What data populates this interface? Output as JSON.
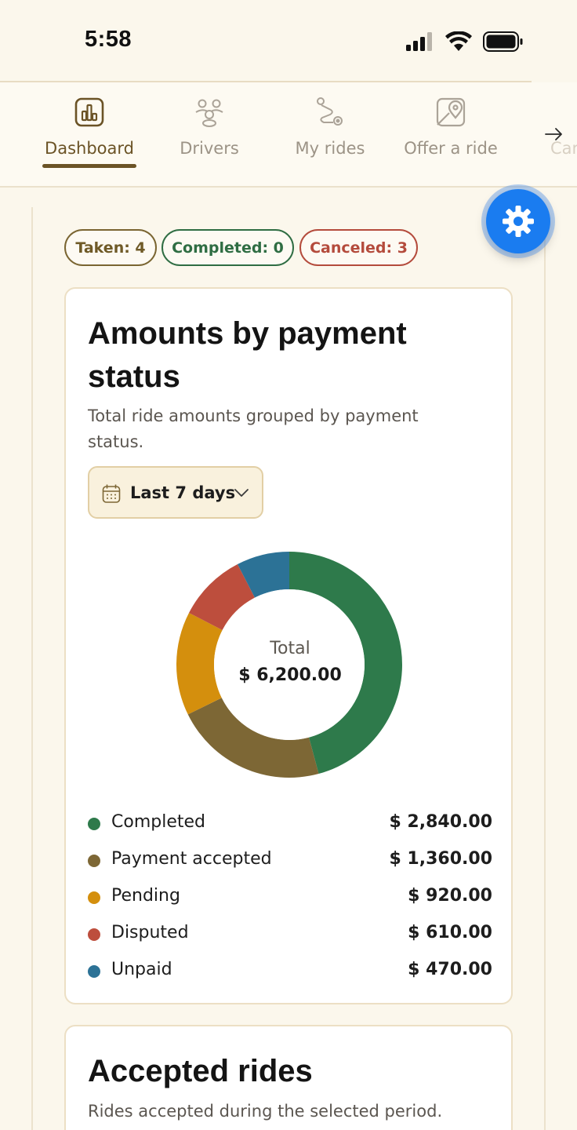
{
  "status_bar": {
    "time": "5:58",
    "icons": [
      "signal-icon",
      "wifi-icon",
      "battery-icon"
    ]
  },
  "nav": {
    "tabs": [
      {
        "label": "Dashboard",
        "icon": "chart-icon",
        "active": true
      },
      {
        "label": "Drivers",
        "icon": "drivers-icon",
        "active": false
      },
      {
        "label": "My rides",
        "icon": "route-icon",
        "active": false
      },
      {
        "label": "Offer a ride",
        "icon": "map-pin-icon",
        "active": false
      }
    ],
    "partial_tab_label": "Car",
    "scroll_icon": "arrow-right-icon"
  },
  "settings_icon": "gear-icon",
  "filters": {
    "taken": "Taken: 4",
    "completed": "Completed: 0",
    "canceled": "Canceled: 3"
  },
  "payment_card": {
    "title": "Amounts by payment status",
    "description": "Total ride amounts grouped by payment status.",
    "range_select": {
      "value": "Last 7 days",
      "icon": "calendar-icon",
      "chevron": "chevron-down-icon"
    },
    "total_label": "Total",
    "total_value": "$ 6,200.00"
  },
  "chart_data": {
    "type": "pie",
    "categories": [
      "Completed",
      "Payment accepted",
      "Pending",
      "Disputed",
      "Unpaid"
    ],
    "values": [
      2840,
      1360,
      920,
      610,
      470
    ],
    "value_labels": [
      "$ 2,840.00",
      "$ 1,360.00",
      "$ 920.00",
      "$ 610.00",
      "$ 470.00"
    ],
    "colors": [
      "#2e7a4b",
      "#7d6735",
      "#d48f0d",
      "#bd4e3d",
      "#2c7296"
    ],
    "legend": "bottom"
  },
  "accepted_card": {
    "title": "Accepted rides",
    "description": "Rides accepted during the selected period."
  },
  "colors": {
    "background": "#fbf7ec",
    "accent": "#6b5326",
    "settings_button": "#1a7cf0"
  }
}
